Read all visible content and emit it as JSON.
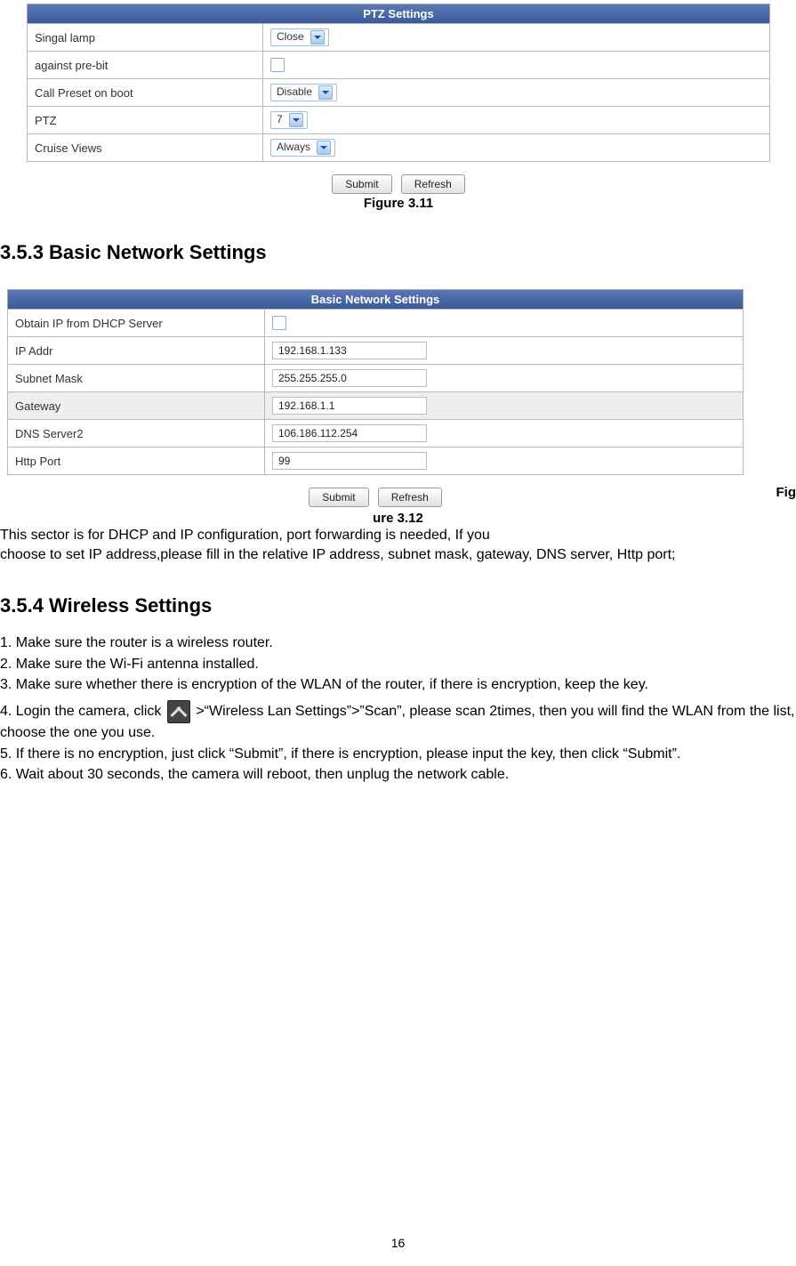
{
  "ptz": {
    "title": "PTZ Settings",
    "rows": {
      "singal_lamp_label": "Singal lamp",
      "singal_lamp_value": "Close",
      "against_label": "against pre-bit",
      "call_preset_label": "Call Preset on boot",
      "call_preset_value": "Disable",
      "ptz_label": "PTZ",
      "ptz_value": "7",
      "cruise_label": "Cruise Views",
      "cruise_value": "Always"
    },
    "submit": "Submit",
    "refresh": "Refresh",
    "caption": "Figure 3.11"
  },
  "sec353_heading": "3.5.3 Basic Network Settings",
  "net": {
    "title": "Basic Network Settings",
    "rows": {
      "dhcp_label": "Obtain IP from DHCP Server",
      "ip_label": "IP Addr",
      "ip_value": "192.168.1.133",
      "subnet_label": "Subnet Mask",
      "subnet_value": "255.255.255.0",
      "gw_label": "Gateway",
      "gw_value": "192.168.1.1",
      "dns_label": "DNS Server2",
      "dns_value": "106.186.112.254",
      "http_label": "Http Port",
      "http_value": "99"
    },
    "submit": "Submit",
    "refresh": "Refresh"
  },
  "fig312_a": "Fig",
  "fig312_b": "ure 3.12",
  "net_desc_1": "This sector is for DHCP and IP configuration, port forwarding is needed, If you",
  "net_desc_2": "choose to set IP address,please fill in the relative IP address, subnet mask, gateway, DNS server, Http port;",
  "sec354_heading": "3.5.4 Wireless Settings",
  "steps": {
    "s1": "1. Make sure the router is a wireless router.",
    "s2": "2. Make sure the Wi-Fi antenna installed.",
    "s3": "3. Make sure whether there is encryption of the WLAN of the router, if there is encryption, keep the key.",
    "s4a": "4. Login the camera, click",
    "s4b": " >“Wireless Lan Settings”>”Scan”, please scan 2times, then you will find the WLAN from the list, choose the one you use.",
    "s5": "5. If there is no encryption, just click “Submit”, if there is encryption, please input the key, then click “Submit”.",
    "s6": "6. Wait about 30 seconds, the camera will reboot, then unplug the network cable."
  },
  "page_number": "16"
}
